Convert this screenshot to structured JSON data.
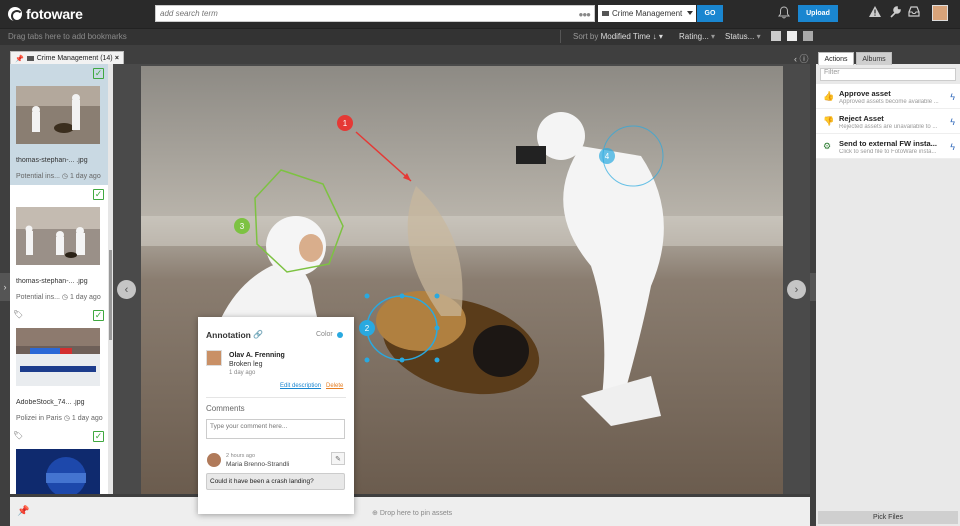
{
  "app": {
    "logo_text": "fotoware"
  },
  "header": {
    "search_placeholder": "add search term",
    "search_dots": "●●●",
    "archive_select": "Crime Management",
    "go_label": "GO",
    "upload_label": "Upload"
  },
  "toolbar": {
    "bookmarks_hint": "Drag tabs here to add bookmarks",
    "sort_prefix": "Sort by",
    "sort_value": "Modified Time",
    "rating_label": "Rating...",
    "status_label": "Status..."
  },
  "tab": {
    "label": "Crime Management",
    "count": "(14)",
    "close": "×"
  },
  "assets": [
    {
      "filename": "thomas-stephan-... .jpg",
      "meta": "Potential ins...",
      "age": "1 day ago",
      "tagged": false
    },
    {
      "filename": "thomas-stephan-... .jpg",
      "meta": "Potential ins...",
      "age": "1 day ago",
      "tagged": false
    },
    {
      "filename": "AdobeStock_74... .jpg",
      "meta": "Polizei in Paris",
      "age": "1 day ago",
      "tagged": true
    },
    {
      "filename": "",
      "meta": "",
      "age": "",
      "tagged": true
    }
  ],
  "markers": [
    {
      "label": "1",
      "color": "#e53935"
    },
    {
      "label": "2",
      "color": "#29a9e0"
    },
    {
      "label": "3",
      "color": "#7dc242"
    },
    {
      "label": "4",
      "color": "#29a9e0"
    }
  ],
  "annotation": {
    "title": "Annotation",
    "color_label": "Color",
    "color": "#29a9e0",
    "author": "Olav A. Frenning",
    "text": "Broken leg",
    "age": "1 day ago",
    "edit_label": "Edit description",
    "delete_label": "Delete",
    "comments_title": "Comments",
    "comment_placeholder": "Type your comment here...",
    "comment_time": "2 hours ago",
    "comment_author": "Maria Brenno-Strandli",
    "comment_text": "Could it have been a crash landing?"
  },
  "pinbar": {
    "drop_text": "Drop here to pin assets"
  },
  "right_panel": {
    "tabs": [
      "Actions",
      "Albums"
    ],
    "filter_placeholder": "Filter",
    "actions": [
      {
        "title": "Approve asset",
        "desc": "Approved assets become available ...",
        "color": "#3fa83f"
      },
      {
        "title": "Reject Asset",
        "desc": "Rejected assets are unavailable to ...",
        "color": "#d9363e"
      },
      {
        "title": "Send to external FW insta...",
        "desc": "Click to send file to FotoWare insta...",
        "color": "#2e7d32"
      }
    ],
    "pick_files_label": "Pick Files"
  }
}
